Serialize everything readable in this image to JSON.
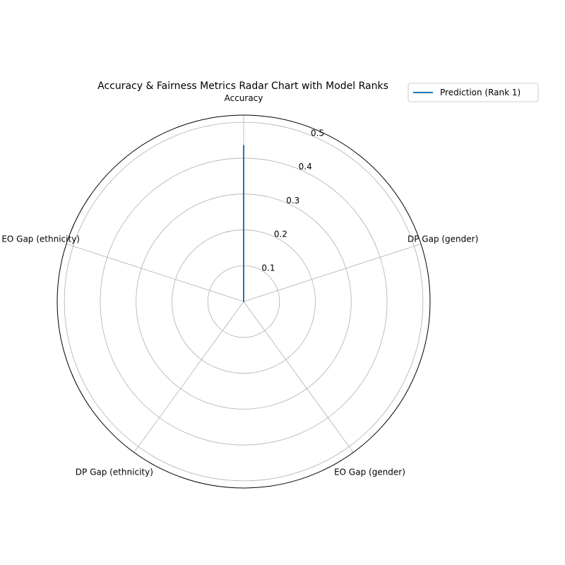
{
  "chart_data": {
    "type": "radar",
    "title": "Accuracy & Fairness Metrics Radar Chart with Model Ranks",
    "axes": [
      "Accuracy",
      "DP Gap (gender)",
      "EO Gap (gender)",
      "DP Gap (ethnicity)",
      "EO Gap (ethnicity)"
    ],
    "rlim": [
      0,
      0.52
    ],
    "rticks": [
      0.1,
      0.2,
      0.3,
      0.4,
      0.5
    ],
    "rtick_labels": [
      "0.1",
      "0.2",
      "0.3",
      "0.4",
      "0.5"
    ],
    "grid": true,
    "legend_position": "top-right",
    "series": [
      {
        "name": "Prediction (Rank 1)",
        "values": [
          0.435,
          0,
          0,
          0,
          0
        ],
        "color": "#1f77b4"
      }
    ]
  }
}
